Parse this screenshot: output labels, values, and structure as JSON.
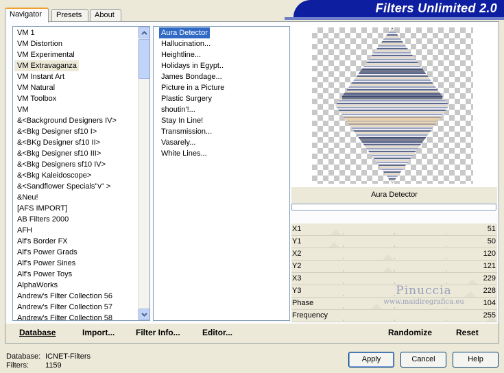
{
  "tabs": [
    {
      "label": "Navigator"
    },
    {
      "label": "Presets"
    },
    {
      "label": "About"
    }
  ],
  "banner": {
    "title": "Filters Unlimited 2.0"
  },
  "categories": [
    "VM 1",
    "VM Distortion",
    "VM Experimental",
    "VM Extravaganza",
    "VM Instant Art",
    "VM Natural",
    "VM Toolbox",
    "VM",
    "&<Background Designers IV>",
    "&<Bkg Designer sf10 I>",
    "&<BKg Designer sf10 II>",
    "&<Bkg Designer sf10 III>",
    "&<Bkg Designers sf10 IV>",
    "&<Bkg Kaleidoscope>",
    "&<Sandflower Specials\"v\" >",
    "&Neu!",
    "[AFS IMPORT]",
    "AB Filters 2000",
    "AFH",
    "Alf's Border FX",
    "Alf's Power Grads",
    "Alf's Power Sines",
    "Alf's Power Toys",
    "AlphaWorks",
    "Andrew's Filter Collection 56",
    "Andrew's Filter Collection 57",
    "Andrew's Filter Collection 58"
  ],
  "filters": [
    "Aura Detector",
    "Hallucination...",
    "Heightline...",
    "Holidays in Egypt..",
    "James Bondage...",
    "Picture in a Picture",
    "Plastic Surgery",
    "shoutin'!...",
    "Stay In Line!",
    "Transmission...",
    "Vasarely...",
    "White Lines..."
  ],
  "selected_filter_name": "Aura Detector",
  "sliders": [
    {
      "label": "X1",
      "value": "51",
      "level": 0.2
    },
    {
      "label": "Y1",
      "value": "50",
      "level": 0.19
    },
    {
      "label": "X2",
      "value": "120",
      "level": 0.47
    },
    {
      "label": "Y2",
      "value": "121",
      "level": 0.47
    },
    {
      "label": "X3",
      "value": "229",
      "level": 0.9
    },
    {
      "label": "Y3",
      "value": "228",
      "level": 0.89
    },
    {
      "label": "Phase",
      "value": "104",
      "level": 0.41
    },
    {
      "label": "Frequency",
      "value": "255",
      "level": 1.0
    }
  ],
  "watermark": {
    "name": "Pinuccia",
    "url": "www.maidiregrafica.eu"
  },
  "panel_buttons": {
    "database": "Database",
    "import": "Import...",
    "filter_info": "Filter Info...",
    "editor": "Editor...",
    "randomize": "Randomize",
    "reset": "Reset"
  },
  "footer": {
    "database_label": "Database:",
    "database_value": "ICNET-Filters",
    "filters_label": "Filters:",
    "filters_value": "1159",
    "apply": "Apply",
    "cancel": "Cancel",
    "help": "Help"
  },
  "colors": {
    "selection_blue": "#316ac5",
    "banner_blue": "#0e1ea0",
    "tab_accent": "#f0a030"
  }
}
